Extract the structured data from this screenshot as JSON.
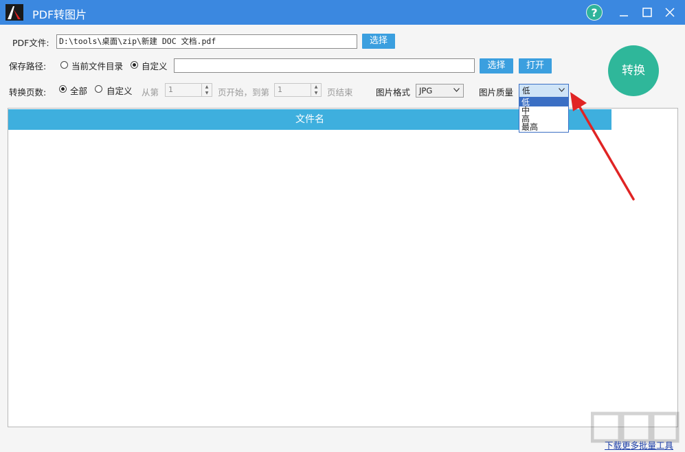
{
  "window": {
    "title": "PDF转图片",
    "help_label": "?"
  },
  "pdf_file": {
    "label": "PDF文件:",
    "value": "D:\\tools\\桌面\\zip\\新建 DOC 文档.pdf",
    "choose_label": "选择"
  },
  "save_path": {
    "label": "保存路径:",
    "option_current": "当前文件目录",
    "option_custom": "自定义",
    "selected": "custom",
    "value": "",
    "choose_label": "选择",
    "open_label": "打开"
  },
  "page_range": {
    "label": "转换页数:",
    "option_all": "全部",
    "option_custom": "自定义",
    "selected": "all",
    "from_label": "从第",
    "from_value": "1",
    "middle_label": "页开始，到第",
    "to_value": "1",
    "end_label": "页结束"
  },
  "image_format": {
    "label": "图片格式",
    "value": "JPG"
  },
  "image_quality": {
    "label": "图片质量",
    "value": "低",
    "options": [
      "低",
      "中",
      "高",
      "最高"
    ],
    "open": true
  },
  "convert_button": {
    "label": "转换"
  },
  "file_list": {
    "column_header": "文件名",
    "rows": []
  },
  "footer": {
    "link_text": "下载更多批量工具"
  },
  "colors": {
    "titlebar": "#3b88e0",
    "accent_button": "#3b9fdf",
    "convert_button": "#2fb79a",
    "list_header": "#3eafde",
    "annotation_arrow": "#e02424"
  }
}
